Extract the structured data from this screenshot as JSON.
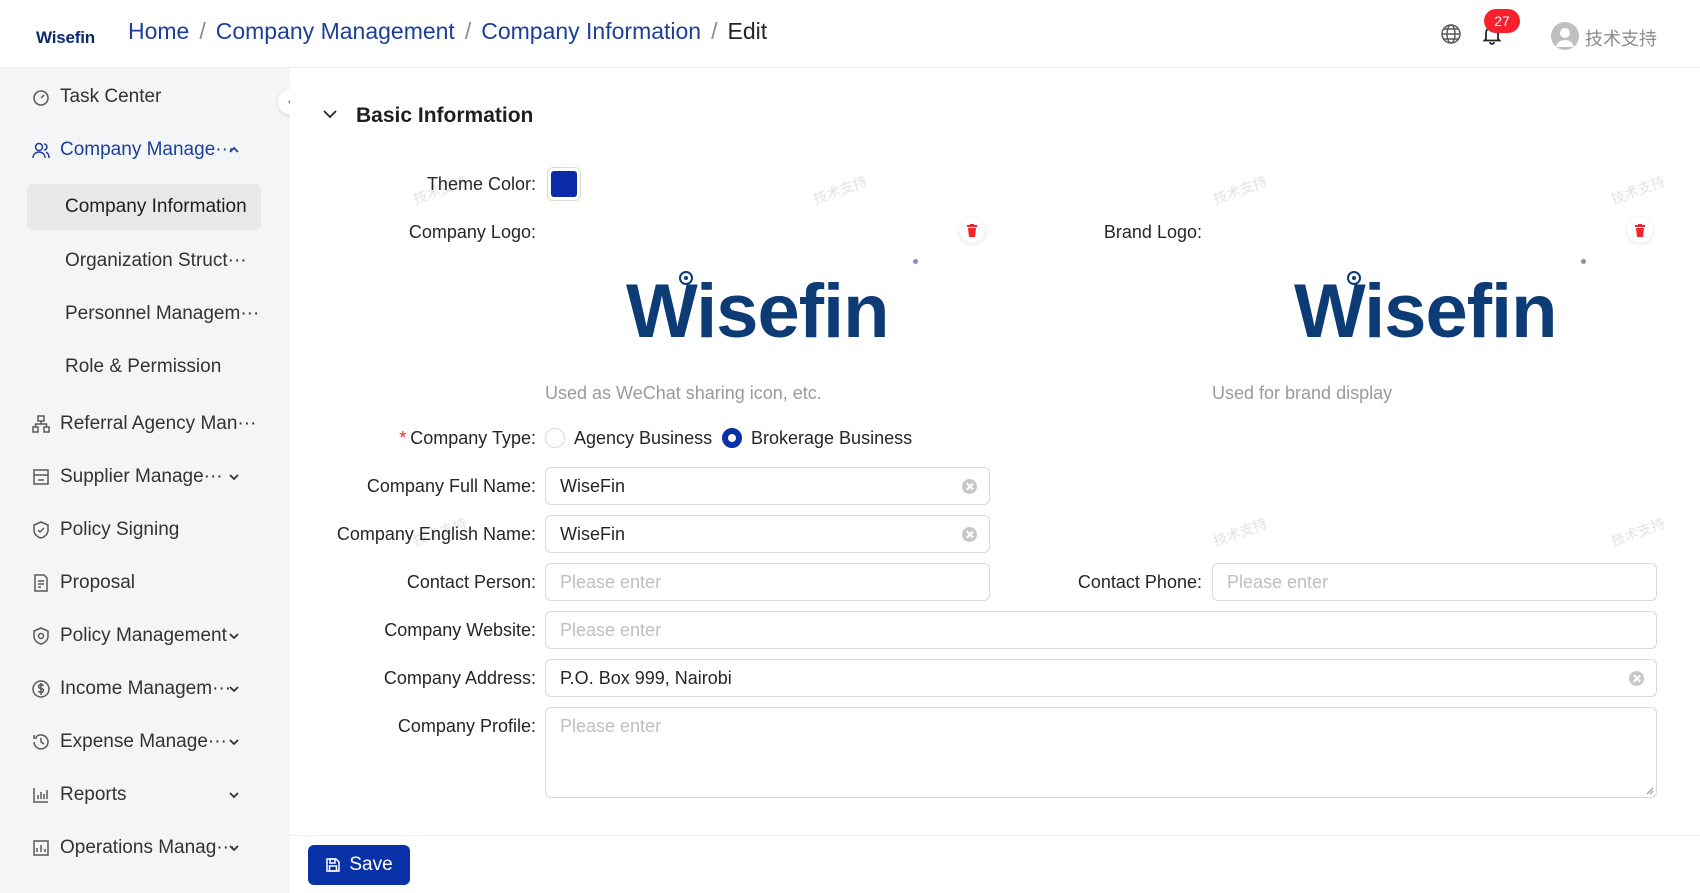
{
  "header": {
    "logo_text": "Wisefin",
    "breadcrumb": [
      "Home",
      "Company Management",
      "Company Information",
      "Edit"
    ],
    "notifications_count": "27",
    "user_name": "技术支持"
  },
  "sidebar": {
    "items": [
      {
        "label": "Task Center",
        "icon": "dashboard-icon"
      },
      {
        "label": "Company Manage···",
        "icon": "users-icon",
        "expanded": true
      },
      {
        "label": "Referral Agency Man···",
        "icon": "org-icon"
      },
      {
        "label": "Supplier Manage···",
        "icon": "store-icon"
      },
      {
        "label": "Policy Signing",
        "icon": "shield-check-icon"
      },
      {
        "label": "Proposal",
        "icon": "document-icon"
      },
      {
        "label": "Policy Management",
        "icon": "shield-icon"
      },
      {
        "label": "Income Managem···",
        "icon": "dollar-icon"
      },
      {
        "label": "Expense Manage···",
        "icon": "expense-icon"
      },
      {
        "label": "Reports",
        "icon": "bar-chart-icon"
      },
      {
        "label": "Operations Manag···",
        "icon": "ops-icon"
      }
    ],
    "sub_items": [
      {
        "label": "Company Information",
        "selected": true
      },
      {
        "label": "Organization Struct···"
      },
      {
        "label": "Personnel Managem···"
      },
      {
        "label": "Role & Permission"
      }
    ]
  },
  "section": {
    "title": "Basic Information"
  },
  "form": {
    "theme_color_label": "Theme Color",
    "theme_color": "#0a2aa8",
    "company_logo_label": "Company Logo",
    "company_logo_text": "Wisefin",
    "company_logo_hint": "Used as WeChat sharing icon, etc.",
    "brand_logo_label": "Brand Logo",
    "brand_logo_text": "Wisefin",
    "brand_logo_hint": "Used for brand display",
    "company_type_label": "Company Type",
    "company_type_options": [
      "Agency Business",
      "Brokerage Business"
    ],
    "company_type_selected": "Brokerage Business",
    "full_name_label": "Company Full Name",
    "full_name_value": "WiseFin",
    "english_name_label": "Company English Name",
    "english_name_value": "WiseFin",
    "contact_person_label": "Contact Person",
    "contact_person_placeholder": "Please enter",
    "contact_phone_label": "Contact Phone",
    "contact_phone_placeholder": "Please enter",
    "website_label": "Company Website",
    "website_placeholder": "Please enter",
    "address_label": "Company Address",
    "address_value": "P.O. Box 999, Nairobi",
    "profile_label": "Company Profile",
    "profile_placeholder": "Please enter",
    "label_suffix": ":"
  },
  "footer": {
    "save_label": "Save"
  },
  "watermark_text": "技术支持",
  "colors": {
    "primary": "#0a32a8",
    "link": "#1b3f9a",
    "logo": "#0c3b76",
    "danger": "#f5222d"
  }
}
